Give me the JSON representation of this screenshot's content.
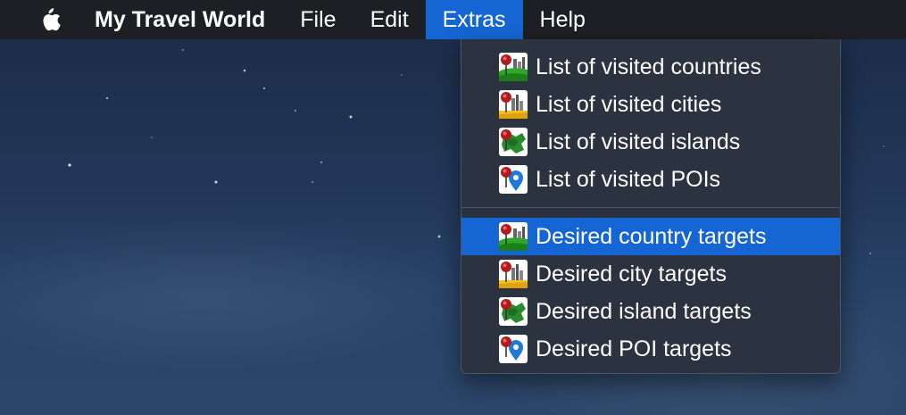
{
  "menubar": {
    "apple_icon": "apple-logo-icon",
    "app_name": "My Travel World",
    "menus": [
      {
        "label": "File",
        "active": false
      },
      {
        "label": "Edit",
        "active": false
      },
      {
        "label": "Extras",
        "active": true
      },
      {
        "label": "Help",
        "active": false
      }
    ]
  },
  "extras_menu": {
    "visited": [
      {
        "label": "List of visited countries",
        "icon": "country-pin-icon"
      },
      {
        "label": "List of visited cities",
        "icon": "city-pin-icon"
      },
      {
        "label": "List of visited islands",
        "icon": "island-pin-icon"
      },
      {
        "label": "List of visited POIs",
        "icon": "poi-pin-icon"
      }
    ],
    "desired": [
      {
        "label": "Desired country targets",
        "icon": "country-pin-icon",
        "highlighted": true
      },
      {
        "label": "Desired city targets",
        "icon": "city-pin-icon",
        "highlighted": false
      },
      {
        "label": "Desired island targets",
        "icon": "island-pin-icon",
        "highlighted": false
      },
      {
        "label": "Desired POI targets",
        "icon": "poi-pin-icon",
        "highlighted": false
      }
    ]
  },
  "colors": {
    "menubar_bg": "#1e1f24",
    "highlight": "#1566d4",
    "dropdown_bg": "#2b3240",
    "text": "#ffffff"
  }
}
